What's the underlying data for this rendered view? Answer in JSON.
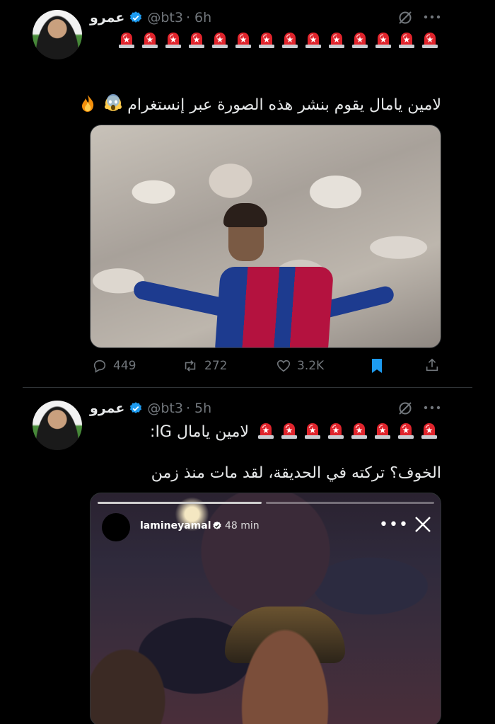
{
  "tweets": [
    {
      "name": "عمرو",
      "handle": "@bt3",
      "time": "· 6h",
      "siren_count": 14,
      "text": "لامين يامال يقوم بنشر هذه الصورة عبر إنستغرام",
      "emojis": [
        "face-screaming-icon",
        "fire-icon"
      ],
      "stats": {
        "replies": "449",
        "retweets": "272",
        "likes": "3.2K"
      }
    },
    {
      "name": "عمرو",
      "handle": "@bt3",
      "time": "· 5h",
      "siren_count": 8,
      "line1": "لامين يامال IG:",
      "text": "الخوف؟ تركته في الحديقة، لقد مات منذ زمن",
      "story": {
        "username": "lamineyamal",
        "time": "48 min",
        "more": "•••"
      }
    }
  ],
  "colors": {
    "accent": "#1d9bf0",
    "muted": "#71767b",
    "text": "#e7e9ea",
    "siren_red": "#e0242c"
  }
}
